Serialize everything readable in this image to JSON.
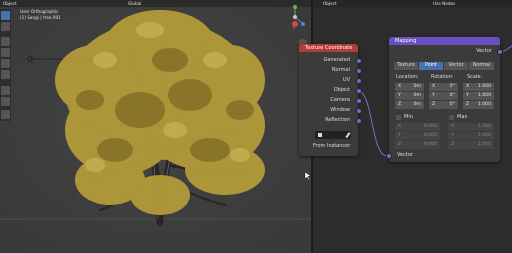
{
  "viewport": {
    "view_name": "User Orthographic",
    "collection_label": "(1) Sangi | tree.001",
    "gizmo_axis": "X",
    "header_items": [
      "Object",
      "Global"
    ]
  },
  "node_editor": {
    "header_items": [
      "Object",
      "Use Nodes"
    ],
    "texcoord": {
      "title": "Texture Coordinate",
      "outputs": [
        "Generated",
        "Normal",
        "UV",
        "Object",
        "Camera",
        "Window",
        "Reflection"
      ],
      "from_instancer": "From Instancer"
    },
    "mapping": {
      "title": "Mapping",
      "output": "Vector",
      "tabs": [
        "Texture",
        "Point",
        "Vector",
        "Normal"
      ],
      "active_tab": "Point",
      "location_label": "Location:",
      "rotation_label": "Rotation:",
      "scale_label": "Scale:",
      "location": [
        {
          "k": "X",
          "v": "0m"
        },
        {
          "k": "Y",
          "v": "0m"
        },
        {
          "k": "Z",
          "v": "0m"
        }
      ],
      "rotation": [
        {
          "k": "X",
          "v": "0°"
        },
        {
          "k": "Y",
          "v": "0°"
        },
        {
          "k": "Z",
          "v": "0°"
        }
      ],
      "scale": [
        {
          "k": "X",
          "v": "1.000"
        },
        {
          "k": "Y",
          "v": "1.000"
        },
        {
          "k": "Z",
          "v": "1.000"
        }
      ],
      "min_label": "Min",
      "max_label": "Max",
      "min": [
        {
          "k": "X",
          "v": "0.000"
        },
        {
          "k": "Y",
          "v": "0.000"
        },
        {
          "k": "Z",
          "v": "0.000"
        }
      ],
      "max": [
        {
          "k": "X",
          "v": "1.000"
        },
        {
          "k": "Y",
          "v": "1.000"
        },
        {
          "k": "Z",
          "v": "1.000"
        }
      ],
      "input": "Vector"
    }
  },
  "colors": {
    "texcoord_header": "#b33b3b",
    "mapping_header": "#6a4fc0",
    "socket_vector": "#6f6fd0",
    "active_tab": "#4b6fb0"
  }
}
